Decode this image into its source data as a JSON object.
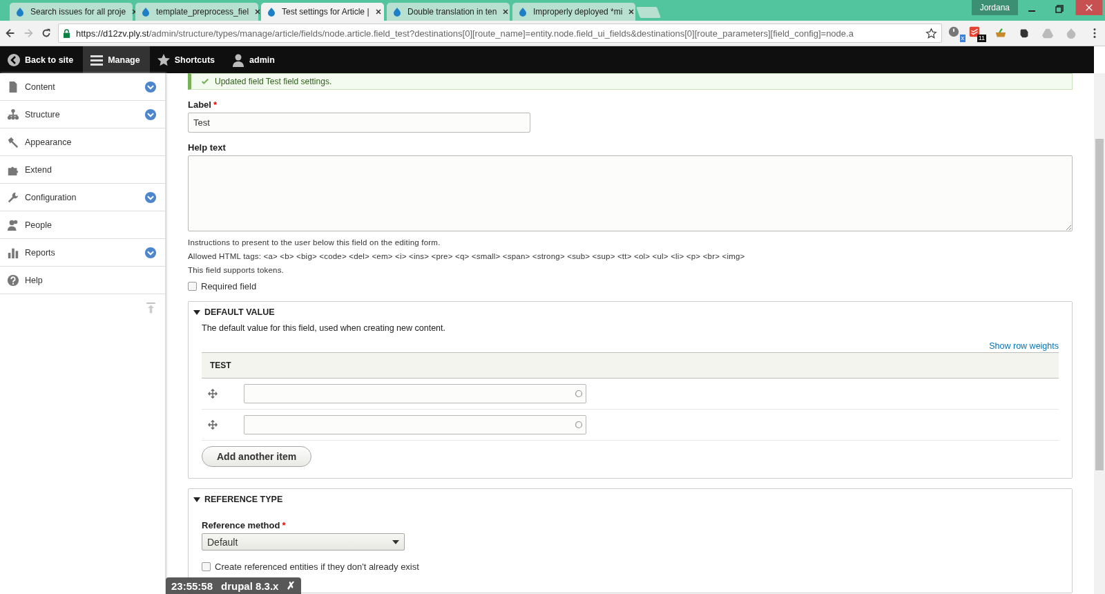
{
  "browser": {
    "tabs": [
      {
        "title": "Search issues for all proje",
        "selected": false
      },
      {
        "title": "template_preprocess_fiel",
        "selected": false
      },
      {
        "title": "Test settings for Article |",
        "selected": true
      },
      {
        "title": "Double translation in ten",
        "selected": false
      },
      {
        "title": "Improperly deployed *mi",
        "selected": false
      }
    ],
    "profile": "Jordana",
    "url_host": "https://d12zv.ply.st",
    "url_path": "/admin/structure/types/manage/article/fields/node.article.field_test?destinations[0][route_name]=entity.node.field_ui_fields&destinations[0][route_parameters][field_config]=node.a",
    "extension_badges": [
      "x",
      "11"
    ]
  },
  "toolbar": {
    "items": [
      {
        "label": "Back to site",
        "kind": "back",
        "selected": false
      },
      {
        "label": "Manage",
        "kind": "menu",
        "selected": true
      },
      {
        "label": "Shortcuts",
        "kind": "star",
        "selected": false
      },
      {
        "label": "admin",
        "kind": "user",
        "selected": false
      }
    ]
  },
  "sidebar": {
    "items": [
      {
        "label": "Content",
        "kind": "page",
        "expandable": true
      },
      {
        "label": "Structure",
        "kind": "tree",
        "expandable": true
      },
      {
        "label": "Appearance",
        "kind": "brush",
        "expandable": false
      },
      {
        "label": "Extend",
        "kind": "puzzle",
        "expandable": false
      },
      {
        "label": "Configuration",
        "kind": "wrench",
        "expandable": true
      },
      {
        "label": "People",
        "kind": "people",
        "expandable": false
      },
      {
        "label": "Reports",
        "kind": "bars",
        "expandable": true
      },
      {
        "label": "Help",
        "kind": "help",
        "expandable": false
      }
    ]
  },
  "message": "Updated field Test field settings.",
  "form": {
    "label_field": {
      "label": "Label",
      "required_mark": "*",
      "value": "Test"
    },
    "help_text": {
      "label": "Help text"
    },
    "descriptions": [
      "Instructions to present to the user below this field on the editing form.",
      "Allowed HTML tags: <a> <b> <big> <code> <del> <em> <i> <ins> <pre> <q> <small> <span> <strong> <sub> <sup> <tt> <ol> <ul> <li> <p> <br> <img>",
      "This field supports tokens."
    ],
    "required_checkbox": {
      "label": "Required field",
      "checked": false
    },
    "default_value": {
      "title": "DEFAULT VALUE",
      "expanded": true,
      "description": "The default value for this field, used when creating new content.",
      "weights_link": "Show row weights",
      "column": "TEST",
      "rows": [
        {
          "kind": "autocomplete"
        },
        {
          "kind": "autocomplete"
        }
      ],
      "add_button": "Add another item"
    },
    "reference_type": {
      "title": "REFERENCE TYPE",
      "expanded": true,
      "method_label": "Reference method",
      "required_mark": "*",
      "method_value": "Default",
      "create_checkbox": {
        "label": "Create referenced entities if they don't already exist",
        "checked": false
      }
    }
  },
  "overlay": {
    "time": "23:55:58",
    "version": "drupal 8.3.x",
    "close": "✗"
  }
}
